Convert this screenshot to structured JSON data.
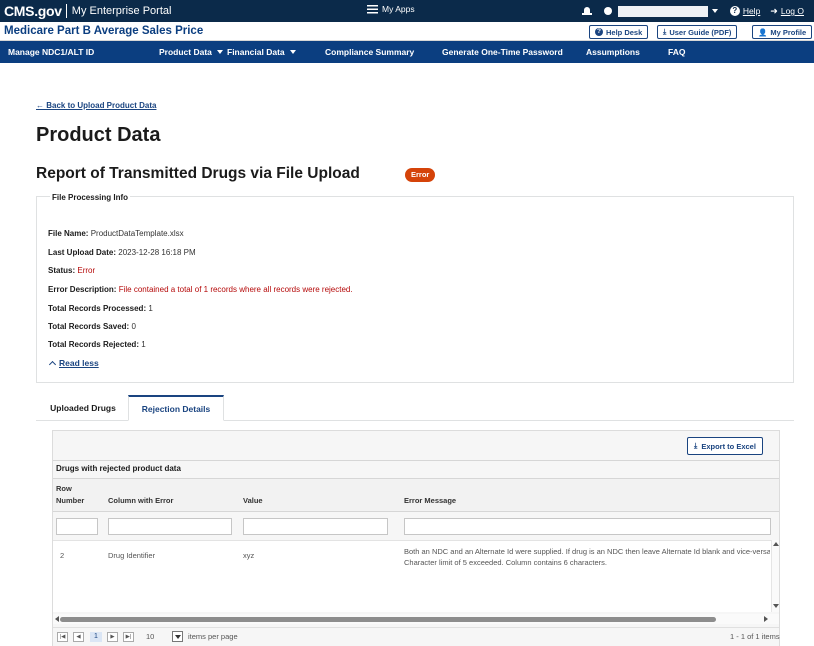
{
  "topbar": {
    "brand_cms": "CMS.gov",
    "brand_portal": "My Enterprise Portal",
    "my_apps": "My Apps",
    "help": "Help",
    "logout": "Log O"
  },
  "header": {
    "app_title": "Medicare Part B Average Sales Price",
    "help_desk": "Help Desk",
    "user_guide": "User Guide (PDF)",
    "my_profile": "My Profile"
  },
  "nav": {
    "items": [
      {
        "label": "Manage NDC1/ALT ID"
      },
      {
        "label": "Product Data"
      },
      {
        "label": "Financial Data"
      },
      {
        "label": "Compliance Summary"
      },
      {
        "label": "Generate One-Time Password"
      },
      {
        "label": "Assumptions"
      },
      {
        "label": "FAQ"
      }
    ]
  },
  "page": {
    "back_link": "← Back to Upload Product Data",
    "title": "Product Data",
    "report_title": "Report of Transmitted Drugs via File Upload",
    "status_badge": "Error"
  },
  "file_info": {
    "legend": "File Processing Info",
    "rows": [
      {
        "label": "File Name:",
        "value": "ProductDataTemplate.xlsx"
      },
      {
        "label": "Last Upload Date:",
        "value": "2023-12-28 16:18 PM"
      },
      {
        "label": "Status:",
        "value": "Error"
      },
      {
        "label": "Error Description:",
        "value": "File contained a total of 1 records where all records were rejected."
      },
      {
        "label": "Total Records Processed:",
        "value": "1"
      },
      {
        "label": "Total Records Saved:",
        "value": "0"
      },
      {
        "label": "Total Records Rejected:",
        "value": "1"
      }
    ],
    "read_less": "Read less"
  },
  "tabs": [
    {
      "label": "Uploaded Drugs"
    },
    {
      "label": "Rejection Details"
    }
  ],
  "grid": {
    "export": "Export to Excel",
    "caption": "Drugs with rejected product data",
    "columns": [
      "Row",
      "Number",
      "Column with Error",
      "Value",
      "Error Message"
    ],
    "row": {
      "row_number": "2",
      "column": "Drug Identifier",
      "value": "xyz",
      "message_line1": "Both an NDC and an Alternate Id were supplied. If drug is an NDC then leave Alternate Id blank and vice-versa",
      "message_line2": "Character limit of 5 exceeded. Column contains 6 characters."
    }
  },
  "pager": {
    "current_page": "1",
    "page_size": "10",
    "items_label": "items per page",
    "count": "1 - 1 of 1 items"
  },
  "colors": {
    "topbar": "#0b2a4a",
    "nav": "#0b3e80",
    "accent": "#1a4480",
    "error": "#d54309",
    "error_text": "#b50909"
  }
}
